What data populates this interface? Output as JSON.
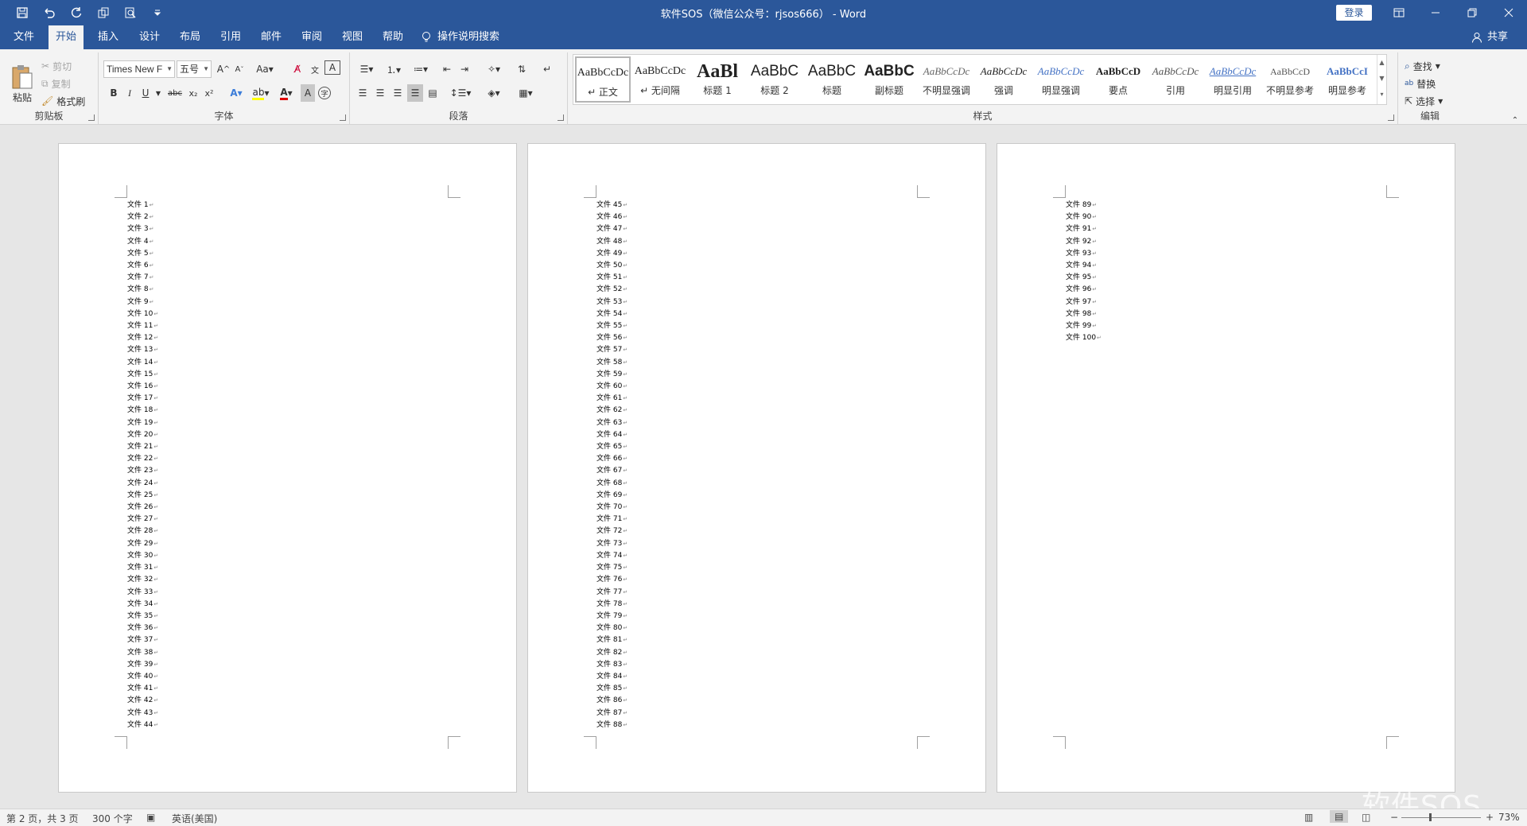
{
  "window": {
    "title": "软件SOS（微信公众号：rjsos666） - Word",
    "login_label": "登录"
  },
  "tabs": [
    {
      "label": "文件"
    },
    {
      "label": "开始"
    },
    {
      "label": "插入"
    },
    {
      "label": "设计"
    },
    {
      "label": "布局"
    },
    {
      "label": "引用"
    },
    {
      "label": "邮件"
    },
    {
      "label": "审阅"
    },
    {
      "label": "视图"
    },
    {
      "label": "帮助"
    }
  ],
  "tellme": "操作说明搜索",
  "share": "共享",
  "clipboard": {
    "paste": "粘贴",
    "cut": "剪切",
    "copy": "复制",
    "format_painter": "格式刷",
    "label": "剪贴板"
  },
  "font": {
    "font_name": "Times New F",
    "font_size": "五号",
    "change_case": "Aa",
    "bold": "B",
    "italic": "I",
    "underline": "U",
    "strike": "abc",
    "subscript": "x₂",
    "superscript": "x²",
    "label": "字体"
  },
  "paragraph": {
    "label": "段落"
  },
  "styles": {
    "label": "样式",
    "items": [
      {
        "preview": "AaBbCcDc",
        "name": "↵ 正文"
      },
      {
        "preview": "AaBbCcDc",
        "name": "↵ 无间隔"
      },
      {
        "preview": "AaBl",
        "name": "标题 1"
      },
      {
        "preview": "AaBbC",
        "name": "标题 2"
      },
      {
        "preview": "AaBbC",
        "name": "标题"
      },
      {
        "preview": "AaBbC",
        "name": "副标题"
      },
      {
        "preview": "AaBbCcDc",
        "name": "不明显强调"
      },
      {
        "preview": "AaBbCcDc",
        "name": "强调"
      },
      {
        "preview": "AaBbCcDc",
        "name": "明显强调"
      },
      {
        "preview": "AaBbCcD",
        "name": "要点"
      },
      {
        "preview": "AaBbCcDc",
        "name": "引用"
      },
      {
        "preview": "AaBbCcDc",
        "name": "明显引用"
      },
      {
        "preview": "AaBbCcD",
        "name": "不明显参考"
      },
      {
        "preview": "AaBbCcI",
        "name": "明显参考"
      }
    ]
  },
  "editing": {
    "find": "查找",
    "replace": "替换",
    "select": "选择",
    "label": "编辑"
  },
  "pages": [
    {
      "lines": [
        "文件 1",
        "文件 2",
        "文件 3",
        "文件 4",
        "文件 5",
        "文件 6",
        "文件 7",
        "文件 8",
        "文件 9",
        "文件 10",
        "文件 11",
        "文件 12",
        "文件 13",
        "文件 14",
        "文件 15",
        "文件 16",
        "文件 17",
        "文件 18",
        "文件 19",
        "文件 20",
        "文件 21",
        "文件 22",
        "文件 23",
        "文件 24",
        "文件 25",
        "文件 26",
        "文件 27",
        "文件 28",
        "文件 29",
        "文件 30",
        "文件 31",
        "文件 32",
        "文件 33",
        "文件 34",
        "文件 35",
        "文件 36",
        "文件 37",
        "文件 38",
        "文件 39",
        "文件 40",
        "文件 41",
        "文件 42",
        "文件 43",
        "文件 44"
      ]
    },
    {
      "lines": [
        "文件 45",
        "文件 46",
        "文件 47",
        "文件 48",
        "文件 49",
        "文件 50",
        "文件 51",
        "文件 52",
        "文件 53",
        "文件 54",
        "文件 55",
        "文件 56",
        "文件 57",
        "文件 58",
        "文件 59",
        "文件 60",
        "文件 61",
        "文件 62",
        "文件 63",
        "文件 64",
        "文件 65",
        "文件 66",
        "文件 67",
        "文件 68",
        "文件 69",
        "文件 70",
        "文件 71",
        "文件 72",
        "文件 73",
        "文件 74",
        "文件 75",
        "文件 76",
        "文件 77",
        "文件 78",
        "文件 79",
        "文件 80",
        "文件 81",
        "文件 82",
        "文件 83",
        "文件 84",
        "文件 85",
        "文件 86",
        "文件 87",
        "文件 88"
      ]
    },
    {
      "lines": [
        "文件 89",
        "文件 90",
        "文件 91",
        "文件 92",
        "文件 93",
        "文件 94",
        "文件 95",
        "文件 96",
        "文件 97",
        "文件 98",
        "文件 99",
        "文件 100"
      ]
    }
  ],
  "status": {
    "page_info": "第 2 页，共 3 页",
    "word_count": "300 个字",
    "language": "英语(美国)",
    "zoom": "73%"
  },
  "watermark": "软件SOS"
}
